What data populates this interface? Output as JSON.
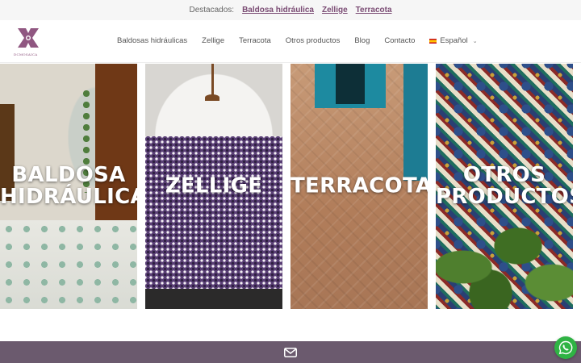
{
  "topbar": {
    "label": "Destacados:",
    "links": [
      "Baldosa hidráulica",
      "Zellige",
      "Terracota"
    ]
  },
  "logo": {
    "text": "DCMOSAICA"
  },
  "nav": {
    "items": [
      "Baldosas hidráulicas",
      "Zellige",
      "Terracota",
      "Otros productos",
      "Blog",
      "Contacto"
    ],
    "language": "Español"
  },
  "tiles": [
    {
      "title_line1": "BALDOSA",
      "title_line2": "HIDRÁULICA"
    },
    {
      "title_line1": "ZELLIGE",
      "title_line2": ""
    },
    {
      "title_line1": "TERRACOTA",
      "title_line2": ""
    },
    {
      "title_line1": "OTROS",
      "title_line2": "PRODUCTOS"
    }
  ],
  "icons": {
    "mail": "mail-icon",
    "whatsapp": "whatsapp-icon",
    "chevron": "chevron-down-icon",
    "flag": "spain-flag-icon"
  },
  "colors": {
    "brand": "#7a4b73",
    "footer": "#6b5a6e",
    "whatsapp": "#2fb344"
  }
}
